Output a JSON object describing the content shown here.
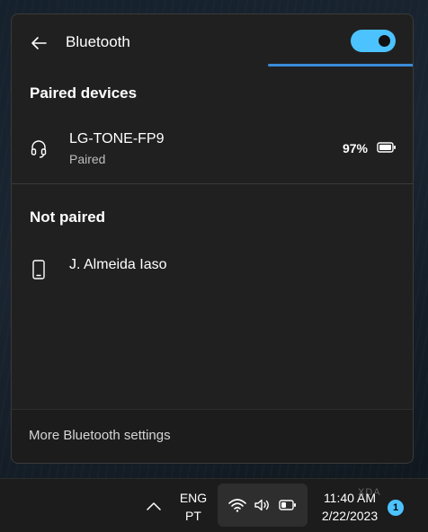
{
  "panel": {
    "title": "Bluetooth",
    "toggle_on": true,
    "progress_fraction": 1.0,
    "accent_color": "#4cc2ff"
  },
  "paired": {
    "section_title": "Paired devices",
    "devices": [
      {
        "name": "LG-TONE-FP9",
        "status": "Paired",
        "battery": "97%",
        "icon": "headset-icon"
      }
    ]
  },
  "not_paired": {
    "section_title": "Not paired",
    "devices": [
      {
        "name": "J. Almeida Iaso",
        "icon": "phone-icon"
      }
    ]
  },
  "footer": {
    "link": "More Bluetooth settings"
  },
  "taskbar": {
    "lang_line1": "ENG",
    "lang_line2": "PT",
    "time": "11:40 AM",
    "date": "2/22/2023",
    "notification_count": "1",
    "tray_icons": [
      "wifi-icon",
      "speaker-icon",
      "battery-icon"
    ]
  }
}
